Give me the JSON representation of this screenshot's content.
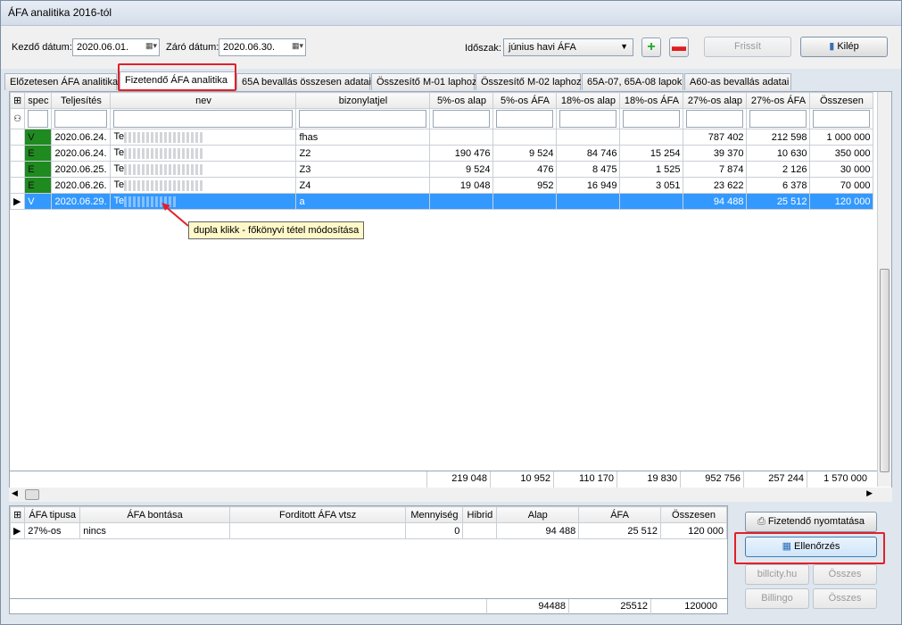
{
  "window_title": "ÁFA analitika 2016-tól",
  "toolbar": {
    "start_label": "Kezdő dátum:",
    "start_value": "2020.06.01.",
    "end_label": "Záró dátum:",
    "end_value": "2020.06.30.",
    "period_label": "Időszak:",
    "period_value": "június havi ÁFA",
    "refresh_label": "Frissít",
    "exit_label": "Kilép"
  },
  "tabs": [
    "Előzetesen ÁFA analitika",
    "Fizetendő ÁFA analitika",
    "65A bevallás összesen adatai",
    "Összesítő M-01 laphoz",
    "Összesítő M-02 laphoz",
    "65A-07, 65A-08 lapok",
    "A60-as bevallás adatai"
  ],
  "grid": {
    "headers": [
      "spec",
      "Teljesítés",
      "nev",
      "bizonylatjel",
      "5%-os alap",
      "5%-os ÁFA",
      "18%-os alap",
      "18%-os ÁFA",
      "27%-os alap",
      "27%-os ÁFA",
      "Összesen"
    ],
    "rows": [
      [
        "V",
        "2020.06.24.",
        "Te",
        "fhas",
        "",
        "",
        "",
        "",
        "787 402",
        "212 598",
        "1 000 000"
      ],
      [
        "E",
        "2020.06.24.",
        "Te",
        "Z2",
        "190 476",
        "9 524",
        "84 746",
        "15 254",
        "39 370",
        "10 630",
        "350 000"
      ],
      [
        "E",
        "2020.06.25.",
        "Te",
        "Z3",
        "9 524",
        "476",
        "8 475",
        "1 525",
        "7 874",
        "2 126",
        "30 000"
      ],
      [
        "E",
        "2020.06.26.",
        "Te",
        "Z4",
        "19 048",
        "952",
        "16 949",
        "3 051",
        "23 622",
        "6 378",
        "70 000"
      ],
      [
        "V",
        "2020.06.29.",
        "Te",
        "a",
        "",
        "",
        "",
        "",
        "94 488",
        "25 512",
        "120 000"
      ]
    ],
    "totals": [
      "219 048",
      "10 952",
      "110 170",
      "19 830",
      "952 756",
      "257 244",
      "1 570 000"
    ]
  },
  "tooltip": "dupla klikk - főkönyvi tétel módosítása",
  "lower": {
    "headers": [
      "ÁFA tipusa",
      "ÁFA bontása",
      "Forditott ÁFA vtsz",
      "Mennyiség",
      "Hibrid",
      "Alap",
      "ÁFA",
      "Összesen"
    ],
    "row": [
      "27%-os",
      "nincs",
      "",
      "0",
      "",
      "94 488",
      "25 512",
      "120 000"
    ],
    "totals": [
      "94488",
      "25512",
      "120000"
    ]
  },
  "side_buttons": {
    "print": "Fizetendő nyomtatása",
    "check": "Ellenőrzés",
    "billcity": "billcity.hu",
    "billingo": "Billingo",
    "osszes1": "Összes",
    "osszes2": "Összes"
  }
}
